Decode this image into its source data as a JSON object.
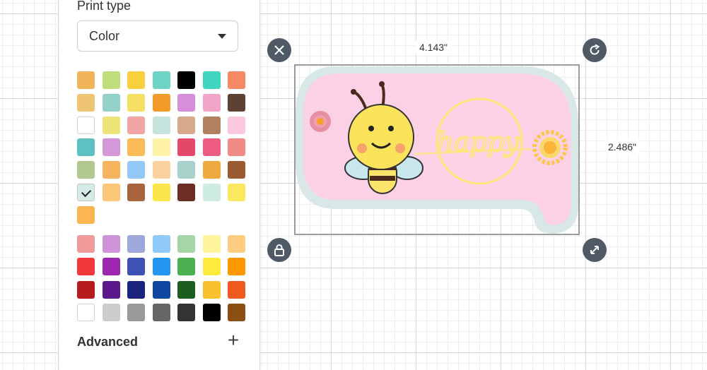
{
  "panel": {
    "print_type_label": "Print type",
    "print_type_value": "Color",
    "advanced_label": "Advanced",
    "palette_top": [
      "#f0b45a",
      "#bfdd79",
      "#f8d03e",
      "#6dd3c3",
      "#000000",
      "#3fd5bf",
      "#f78967",
      "#efc473",
      "#94d2c9",
      "#f6e064",
      "#f39b29",
      "#d48fd8",
      "#f2a4c7",
      "#5d4133",
      "#ffffff",
      "#ede57a",
      "#f2a5a5",
      "#c5e2dd",
      "#d6a98c",
      "#b08061",
      "#fbc8df",
      "#5fc0c1",
      "#d497d8",
      "#fbbb59",
      "#fdf2a6",
      "#e5476b",
      "#ec5c80",
      "#f18b86",
      "#b1c991",
      "#f7b35e",
      "#94c8f6",
      "#fbcf9e",
      "#a8d3cb",
      "#eeaa3d",
      "#9b5b32",
      "#d4ebe7",
      "#fdc77b",
      "#a8653d",
      "#fbe64b",
      "#6c2e24",
      "#ceece4",
      "#fbe860",
      "#fbb652"
    ],
    "palette_bottom": [
      "#ef9a9a",
      "#ce93d8",
      "#9fa8da",
      "#90caf9",
      "#a5d6a7",
      "#fff59d",
      "#ffcc80",
      "#f2383d",
      "#9c27b0",
      "#3f51b5",
      "#2196f3",
      "#4caf50",
      "#ffeb3b",
      "#ff9800",
      "#b71c1c",
      "#5b1a8c",
      "#1a237e",
      "#0d47a1",
      "#1b5e20",
      "#fbc02d",
      "#ef5b1f",
      "#ffffff",
      "#cccccc",
      "#999999",
      "#666666",
      "#333333",
      "#000000",
      "#8b4f13"
    ],
    "selected_swatch_index": 35
  },
  "canvas": {
    "width_label": "4.143\"",
    "height_label": "2.486\"",
    "handles": [
      "close-icon",
      "rotate-icon",
      "lock-icon",
      "resize-icon"
    ]
  },
  "artwork": {
    "text": "happy",
    "bubble_color": "#fdd1e5",
    "outline_color": "#d7e8e6",
    "accent_yellow": "#fbe77a"
  }
}
